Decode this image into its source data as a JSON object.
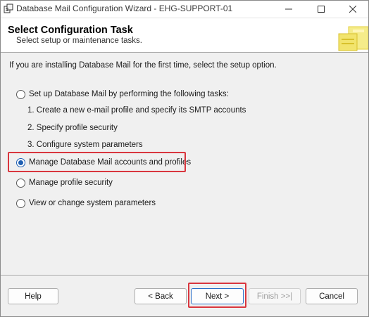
{
  "window": {
    "title": "Database Mail Configuration Wizard - EHG-SUPPORT-01",
    "icons": {
      "app": "wizard-app-icon",
      "minimize": "minimize-icon",
      "maximize": "maximize-icon",
      "close": "close-icon"
    }
  },
  "header": {
    "title": "Select Configuration Task",
    "subtitle": "Select setup or maintenance tasks.",
    "graphic": "wizard-banner-graphic"
  },
  "body": {
    "intro": "If you are installing Database Mail for the first time, select the setup option.",
    "options": [
      {
        "label": "Set up Database Mail by performing the following tasks:",
        "checked": false
      },
      {
        "label": "Manage Database Mail accounts and profiles",
        "checked": true
      },
      {
        "label": "Manage profile security",
        "checked": false
      },
      {
        "label": "View or change system parameters",
        "checked": false
      }
    ],
    "setup_steps": [
      "1. Create a new e-mail profile and specify its SMTP accounts",
      "2. Specify profile security",
      "3. Configure system parameters"
    ]
  },
  "buttons": {
    "help": "Help",
    "back": "< Back",
    "next": "Next >",
    "finish": "Finish >>|",
    "cancel": "Cancel"
  },
  "colors": {
    "highlight": "#d9363e",
    "radio_selected": "#1e5fb3"
  }
}
